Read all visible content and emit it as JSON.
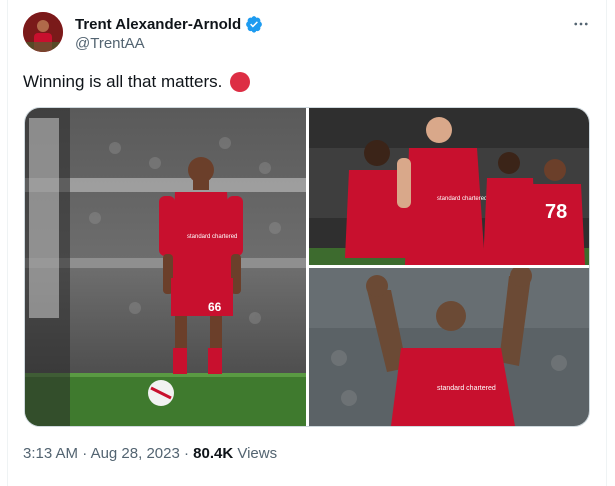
{
  "author": {
    "name": "Trent Alexander-Arnold",
    "handle": "@TrentAA",
    "verified": true
  },
  "tweet": {
    "text": "Winning is all that matters.",
    "emoji": "red-circle"
  },
  "media": {
    "photo_1": {
      "shirt_number": "66",
      "sponsor": "standard chartered"
    },
    "photo_2": {
      "shirt_number": "78",
      "sponsor": "standard chartered"
    },
    "photo_3": {
      "sponsor": "standard chartered"
    }
  },
  "meta": {
    "time": "3:13 AM",
    "separator": "·",
    "date": "Aug 28, 2023",
    "views_count": "80.4K",
    "views_label": "Views"
  },
  "colors": {
    "liverpool_red": "#c8102e",
    "verified_blue": "#1d9bf0",
    "text_secondary": "#536471"
  }
}
